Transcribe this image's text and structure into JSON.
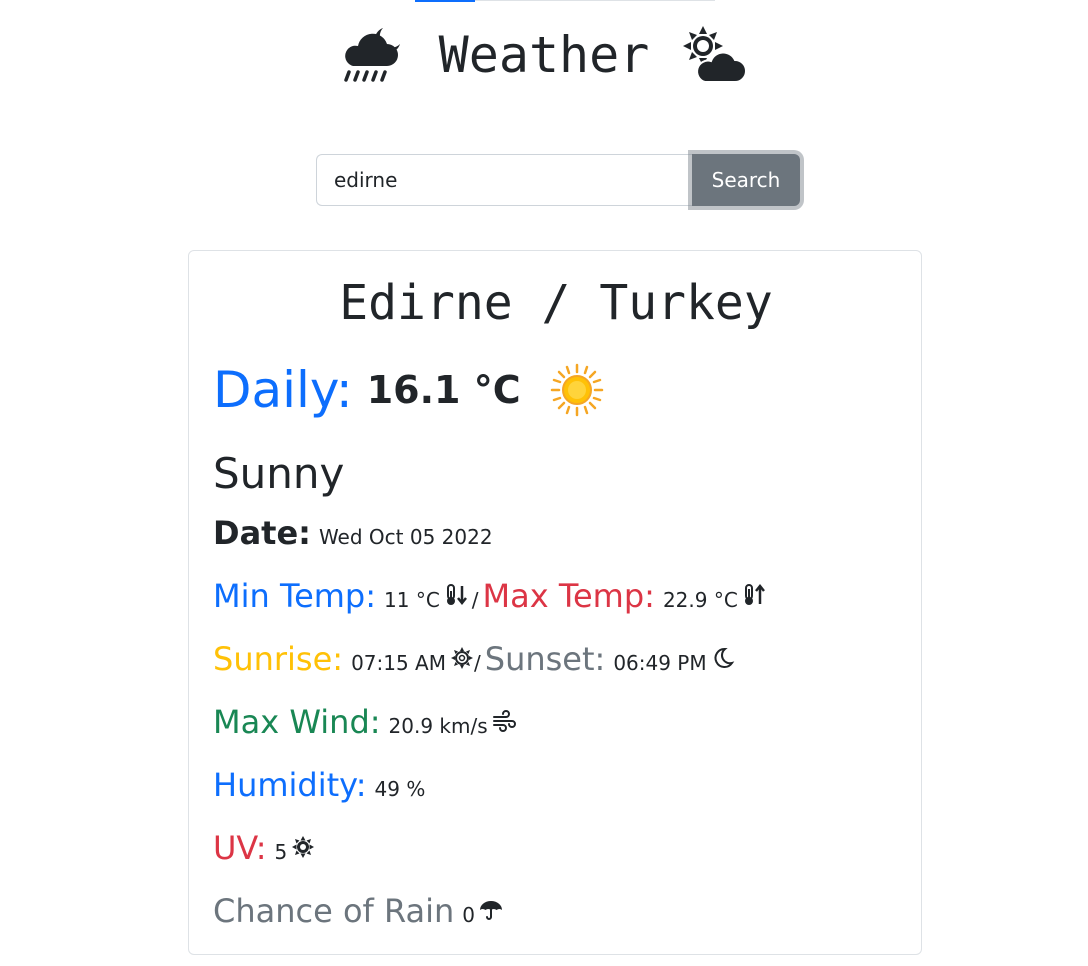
{
  "app": {
    "title": "Weather",
    "header_icons": [
      "cloud-moon-rain-icon",
      "cloud-sun-icon"
    ]
  },
  "search": {
    "value": "edirne",
    "button_label": "Search"
  },
  "weather": {
    "location": "Edirne / Turkey",
    "daily_label": "Daily:",
    "daily_temp": "16.1 °C",
    "condition_icon": "sun-icon",
    "condition": "Sunny",
    "date_label": "Date:",
    "date_value": "Wed Oct 05 2022",
    "min_temp_label": "Min Temp:",
    "min_temp_value": "11 °C",
    "max_temp_label": "Max Temp:",
    "max_temp_value": "22.9 °C",
    "temp_separator": "/",
    "sunrise_label": "Sunrise:",
    "sunrise_value": "07:15 AM",
    "sun_separator": "/",
    "sunset_label": "Sunset:",
    "sunset_value": "06:49 PM",
    "wind_label": "Max Wind:",
    "wind_value": "20.9 km/s",
    "humidity_label": "Humidity:",
    "humidity_value": "49 %",
    "uv_label": "UV:",
    "uv_value": "5",
    "rain_label": "Chance of Rain",
    "rain_value": "0"
  },
  "colors": {
    "primary": "#0d6efd",
    "danger": "#dc3545",
    "warning": "#ffc107",
    "secondary": "#6c757d",
    "success": "#198754",
    "dark": "#212529"
  }
}
